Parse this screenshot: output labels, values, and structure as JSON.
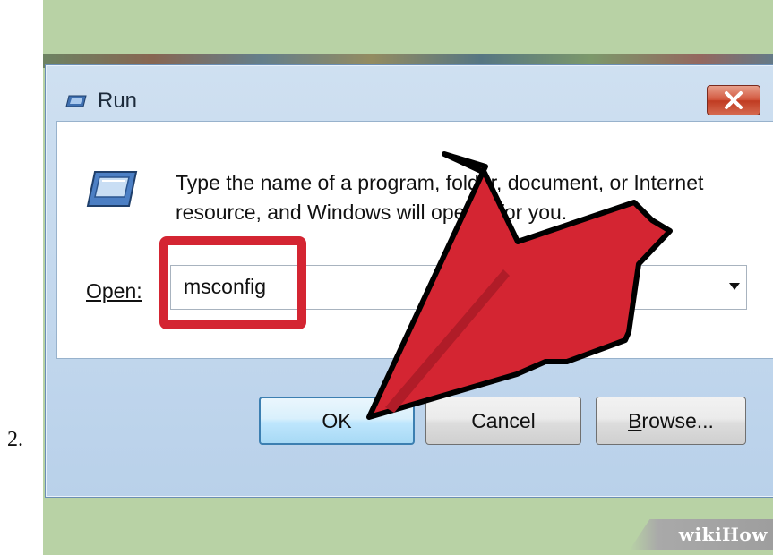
{
  "step": {
    "number": "2."
  },
  "window": {
    "title": "Run",
    "title_icon": "run-icon",
    "close_icon": "close-icon"
  },
  "dialog": {
    "description": "Type the name of a program, folder, document, or Internet resource, and Windows will open it for you.",
    "open_label": "Open:",
    "open_value": "msconfig",
    "dropdown_icon": "chevron-down-icon",
    "buttons": {
      "ok": "OK",
      "cancel": "Cancel",
      "browse": "Browse..."
    }
  },
  "annotation": {
    "arrow_color": "#d42532",
    "highlight_color": "#d42532"
  },
  "watermark": {
    "text": "wikiHow"
  }
}
